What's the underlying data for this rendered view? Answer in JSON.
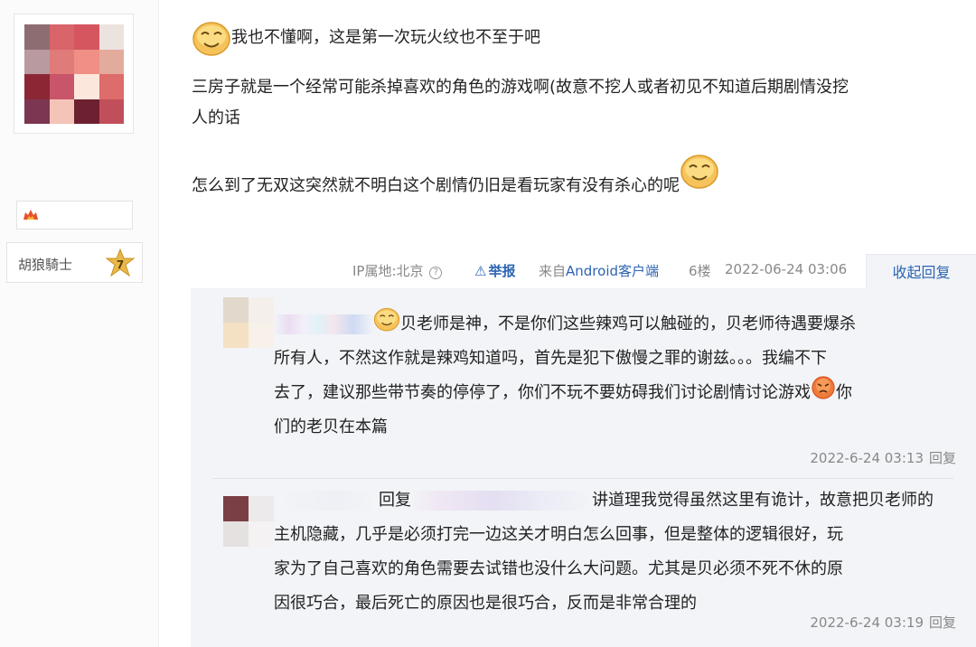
{
  "author": {
    "avatar_colors": [
      "#8e6d72",
      "#d9646a",
      "#d5565f",
      "#ece3df",
      "#b89aa0",
      "#df7b78",
      "#f08f86",
      "#e3ab9b",
      "#8b2735",
      "#c85569",
      "#fce7dc",
      "#dd6c6a",
      "#7c3652",
      "#f5c4b8",
      "#6d2030",
      "#c14f5b"
    ],
    "level_name": "胡狼騎士",
    "level_number": "7"
  },
  "post": {
    "line1": "我也不懂啊，这是第一次玩火纹也不至于吧",
    "line2": "三房子就是一个经常可能杀掉喜欢的角色的游戏啊(故意不挖人或者初见不知道后期剧情没挖",
    "line3": "人的话",
    "line4": "怎么到了无双这突然就不明白这个剧情仍旧是看玩家有没有杀心的呢"
  },
  "footer": {
    "ip_label": "IP属地:北京",
    "help_glyph": "?",
    "warn_glyph": "⚠",
    "report_label": "举报",
    "client_prefix": "来自",
    "client_link": "Android客户端",
    "floor": "6楼",
    "timestamp": "2022-06-24 03:06",
    "collapse_label": "收起回复"
  },
  "replies": [
    {
      "avatar_colors": [
        "#e3d8cc",
        "#f4efea",
        "#f4e1c4",
        "#f7f1ea"
      ],
      "line1": "贝老师是神，不是你们这些辣鸡可以触碰的，贝老师待遇要爆杀",
      "line2": "所有人，不然这作就是辣鸡知道吗，首先是犯下傲慢之罪的谢兹。。。我编不下",
      "line3": "去了，建议那些带节奏的停停了，你们不玩不要妨碍我们讨论剧情讨论游戏",
      "line3b": "你",
      "line4": "们的老贝在本篇",
      "time": "2022-6-24 03:13",
      "reply_label": "回复"
    },
    {
      "avatar_colors": [
        "#7a3f44",
        "#eceaea",
        "#e5e1e1",
        "#f4f2f2"
      ],
      "reply_prefix": "回复",
      "line1": "讲道理我觉得虽然这里有诡计，故意把贝老师的",
      "line2": "主机隐藏，几乎是必须打完一边这关才明白怎么回事，但是整体的逻辑很好，玩",
      "line3": "家为了自己喜欢的角色需要去试错也没什么大问题。尤其是贝必须不死不休的原",
      "line4": "因很巧合，最后死亡的原因也是很巧合，反而是非常合理的",
      "time": "2022-6-24 03:19",
      "reply_label": "回复"
    }
  ]
}
